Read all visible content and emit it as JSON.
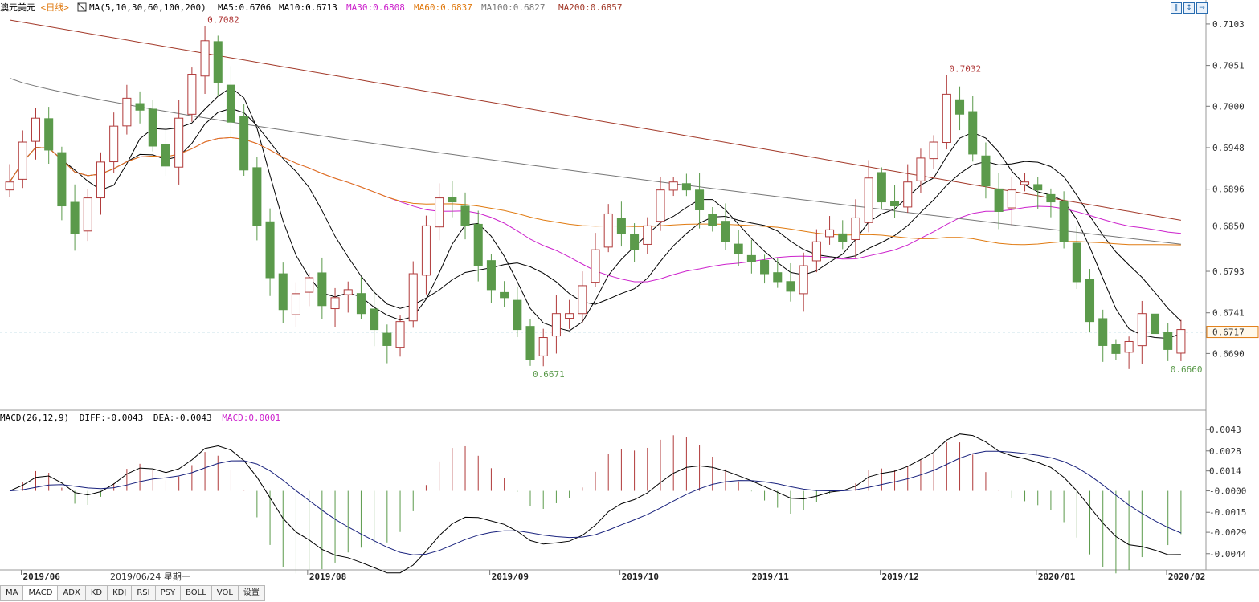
{
  "header": {
    "symbol": "澳元美元",
    "period": "<日线>",
    "ma_spec": "MA(5,10,30,60,100,200)",
    "ma5": "MA5:0.6706",
    "ma10": "MA10:0.6713",
    "ma30": "MA30:0.6808",
    "ma60": "MA60:0.6837",
    "ma100": "MA100:0.6827",
    "ma200": "MA200:0.6857"
  },
  "window_buttons": [
    "‖",
    "↕",
    "→"
  ],
  "macd_header": {
    "spec": "MACD(26,12,9)",
    "diff": "DIFF:-0.0043",
    "dea": "DEA:-0.0043",
    "macd": "MACD:0.0001"
  },
  "x_axis": {
    "labels": [
      "2019/06",
      "2019/08",
      "2019/09",
      "2019/10",
      "2019/11",
      "2019/12",
      "2020/01",
      "2020/02"
    ],
    "crosshair_date": "2019/06/24 星期一"
  },
  "tabs": [
    "MA",
    "MACD",
    "ADX",
    "KD",
    "KDJ",
    "RSI",
    "PSY",
    "BOLL",
    "VOL",
    "设置"
  ],
  "colors": {
    "up": "#b03a3a",
    "down": "#5b9a4b",
    "ma5": "#000000",
    "ma10": "#000000",
    "ma30": "#cc22cc",
    "ma60": "#e07a10",
    "ma100": "#777777",
    "ma200": "#a33a2a",
    "hist_up": "#b03a3a",
    "hist_down": "#5b9a4b",
    "diff": "#000000",
    "dea": "#1a237e",
    "current_line": "#2a8aa5",
    "accent": "#2a6db0"
  },
  "chart_data": [
    {
      "type": "candlestick",
      "title": "澳元美元<日线>",
      "y_ticks": [
        "0.7103",
        "0.7051",
        "0.7000",
        "0.6948",
        "0.6896",
        "0.6793",
        "0.6741",
        "0.6690"
      ],
      "ylim": [
        0.6625,
        0.7115
      ],
      "series": [
        {
          "name": "MA5",
          "value": 0.6706
        },
        {
          "name": "MA10",
          "value": 0.6713
        },
        {
          "name": "MA30",
          "value": 0.6808
        },
        {
          "name": "MA60",
          "value": 0.6837
        },
        {
          "name": "MA100",
          "value": 0.6827
        },
        {
          "name": "MA200",
          "value": 0.6857
        }
      ],
      "annotations": [
        {
          "text": "0.7082",
          "x": "2019/07",
          "y": 0.7082
        },
        {
          "text": "0.6671",
          "x": "2019/10",
          "y": 0.6671
        },
        {
          "text": "0.7032",
          "x": "2019/12",
          "y": 0.7032
        },
        {
          "text": "0.6660",
          "x": "2020/02",
          "y": 0.666
        }
      ],
      "markers": [
        {
          "text": "0.6850",
          "y": 0.685
        },
        {
          "text": "0.6717",
          "y": 0.6717
        }
      ],
      "current_price": 0.6717,
      "closes": [
        0.6905,
        0.6955,
        0.6985,
        0.6945,
        0.6875,
        0.684,
        0.6885,
        0.693,
        0.6975,
        0.701,
        0.6995,
        0.695,
        0.6925,
        0.6985,
        0.704,
        0.7082,
        0.703,
        0.698,
        0.692,
        0.685,
        0.6785,
        0.6745,
        0.6765,
        0.6785,
        0.675,
        0.676,
        0.677,
        0.674,
        0.672,
        0.67,
        0.673,
        0.679,
        0.685,
        0.6885,
        0.688,
        0.685,
        0.68,
        0.677,
        0.676,
        0.672,
        0.6682,
        0.671,
        0.674,
        0.674,
        0.6775,
        0.682,
        0.6865,
        0.684,
        0.682,
        0.685,
        0.6895,
        0.6905,
        0.6895,
        0.687,
        0.685,
        0.683,
        0.6815,
        0.6805,
        0.679,
        0.678,
        0.6768,
        0.68,
        0.683,
        0.6845,
        0.683,
        0.686,
        0.691,
        0.688,
        0.6875,
        0.6905,
        0.6935,
        0.6955,
        0.7015,
        0.699,
        0.694,
        0.69,
        0.6868,
        0.6895,
        0.6905,
        0.6895,
        0.688,
        0.683,
        0.678,
        0.673,
        0.67,
        0.669,
        0.6705,
        0.674,
        0.6715,
        0.6695,
        0.672
      ]
    },
    {
      "type": "bar",
      "title": "MACD(26,12,9)",
      "y_ticks": [
        "0.0043",
        "0.0028",
        "0.0014",
        "-0.0000",
        "-0.0015",
        "-0.0029",
        "-0.0044"
      ],
      "ylim": [
        -0.0052,
        0.0047
      ],
      "series": [
        {
          "name": "DIFF",
          "value": -0.0043
        },
        {
          "name": "DEA",
          "value": -0.0043
        },
        {
          "name": "MACD",
          "value": 0.0001
        }
      ]
    }
  ]
}
